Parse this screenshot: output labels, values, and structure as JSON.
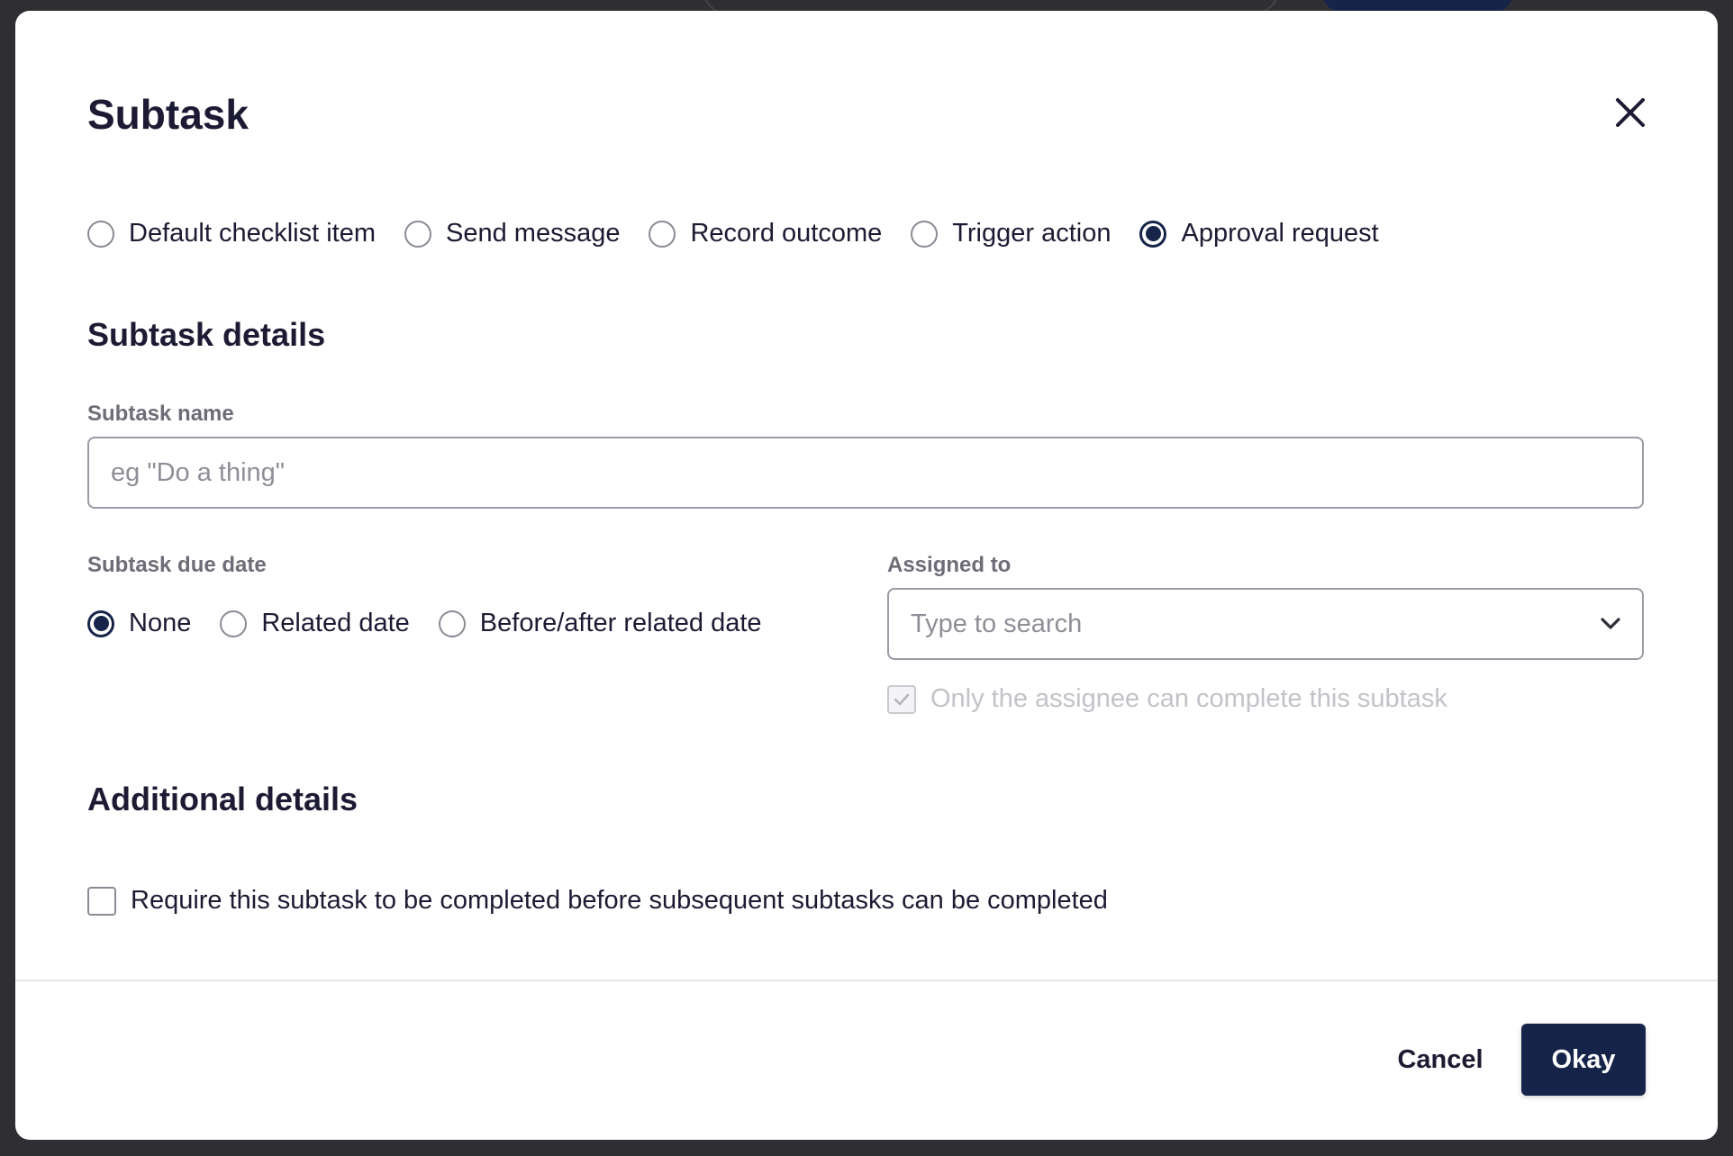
{
  "modal": {
    "title": "Subtask",
    "close_icon": "close-icon"
  },
  "subtask_types": [
    {
      "label": "Default checklist item",
      "checked": false
    },
    {
      "label": "Send message",
      "checked": false
    },
    {
      "label": "Record outcome",
      "checked": false
    },
    {
      "label": "Trigger action",
      "checked": false
    },
    {
      "label": "Approval request",
      "checked": true
    }
  ],
  "details": {
    "heading": "Subtask details",
    "name_label": "Subtask name",
    "name_placeholder": "eg \"Do a thing\"",
    "due_date_label": "Subtask due date",
    "due_date_options": [
      {
        "label": "None",
        "checked": true
      },
      {
        "label": "Related date",
        "checked": false
      },
      {
        "label": "Before/after related date",
        "checked": false
      }
    ],
    "assigned_label": "Assigned to",
    "assigned_placeholder": "Type to search",
    "assignee_only_label": "Only the assignee can complete this subtask",
    "assignee_only_checked": true,
    "assignee_only_disabled": true
  },
  "additional": {
    "heading": "Additional details",
    "require_label": "Require this subtask to be completed before subsequent subtasks can be completed",
    "require_checked": false
  },
  "footer": {
    "cancel_label": "Cancel",
    "okay_label": "Okay"
  },
  "colors": {
    "primary": "#16244a",
    "text": "#1c1b33",
    "muted_label": "#6d6d78",
    "disabled_text": "#c2c2c9"
  }
}
